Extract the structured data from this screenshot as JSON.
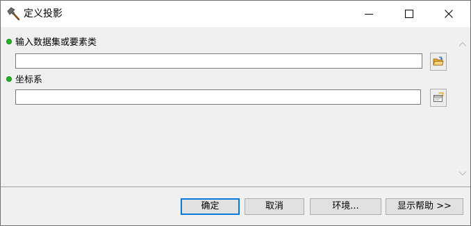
{
  "window": {
    "title": "定义投影",
    "title_icon": "hammer-icon",
    "controls": {
      "minimize_icon": "minimize-icon",
      "maximize_icon": "maximize-icon",
      "close_icon": "close-icon"
    }
  },
  "form": {
    "fields": [
      {
        "label": "输入数据集或要素类",
        "value": "",
        "required": true,
        "browse_icon": "open-folder-icon"
      },
      {
        "label": "坐标系",
        "value": "",
        "required": true,
        "browse_icon": "coordinate-properties-icon"
      }
    ]
  },
  "buttons": {
    "ok": "确定",
    "cancel": "取消",
    "environments": "环境...",
    "show_help": "显示帮助 >>"
  },
  "colors": {
    "required_dot": "#26b526",
    "default_button_border": "#0078d7",
    "dialog_background": "#f0f0f0",
    "folder_yellow": "#f2c14e"
  }
}
